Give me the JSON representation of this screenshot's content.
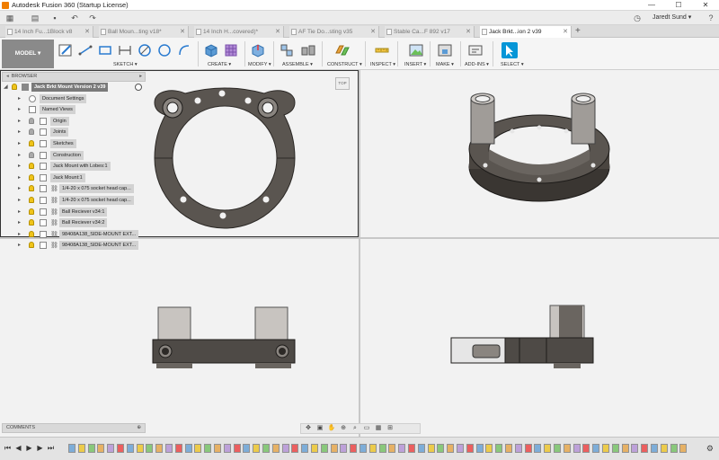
{
  "window": {
    "title": "Autodesk Fusion 360 (Startup License)",
    "minimize": "—",
    "maximize": "☐",
    "close": "✕"
  },
  "qat": {
    "user_name": "Jaredt Sund ▾",
    "help": "?"
  },
  "tabs": [
    {
      "label": "14 Inch Fu...1Block v8"
    },
    {
      "label": "Ball Moun...ting v18*"
    },
    {
      "label": "14 Inch H...covered)*"
    },
    {
      "label": "AF Tie Do...sting v35"
    },
    {
      "label": "Stable Ca...F 892 v17"
    },
    {
      "label": "Jack Brkt...ion 2 v39",
      "active": true
    }
  ],
  "toolbar": {
    "workspace": "MODEL ▾",
    "groups": [
      {
        "label": "SKETCH ▾"
      },
      {
        "label": "CREATE ▾"
      },
      {
        "label": "MODIFY ▾"
      },
      {
        "label": "ASSEMBLE ▾"
      },
      {
        "label": "CONSTRUCT ▾"
      },
      {
        "label": "INSPECT ▾"
      },
      {
        "label": "INSERT ▾"
      },
      {
        "label": "MAKE ▾"
      },
      {
        "label": "ADD-INS ▾"
      },
      {
        "label": "SELECT ▾"
      }
    ]
  },
  "browser": {
    "title": "BROWSER",
    "root": "Jack Brkt Mount Version 2 v39",
    "items": [
      {
        "label": "Document Settings"
      },
      {
        "label": "Named Views"
      },
      {
        "label": "Origin"
      },
      {
        "label": "Joints"
      },
      {
        "label": "Sketches"
      },
      {
        "label": "Construction"
      },
      {
        "label": "Jack Mount with Lobes:1"
      },
      {
        "label": "Jack Mount:1"
      },
      {
        "label": "1/4-20 x 075 socket head cap..."
      },
      {
        "label": "1/4-20 x 075 socket head cap..."
      },
      {
        "label": "Ball Reciever v34:1"
      },
      {
        "label": "Ball Reciever v34:2"
      },
      {
        "label": "98408A138_SIDE-MOUNT EXT..."
      },
      {
        "label": "98408A138_SIDE-MOUNT EXT..."
      }
    ]
  },
  "viewcube_label": "TOP",
  "comments": {
    "title": "COMMENTS",
    "add": "⊕"
  },
  "colors": {
    "part": "#5a5550",
    "part_dark": "#3a3632",
    "hole": "#f2f2f2",
    "accent": "#0696d7"
  }
}
